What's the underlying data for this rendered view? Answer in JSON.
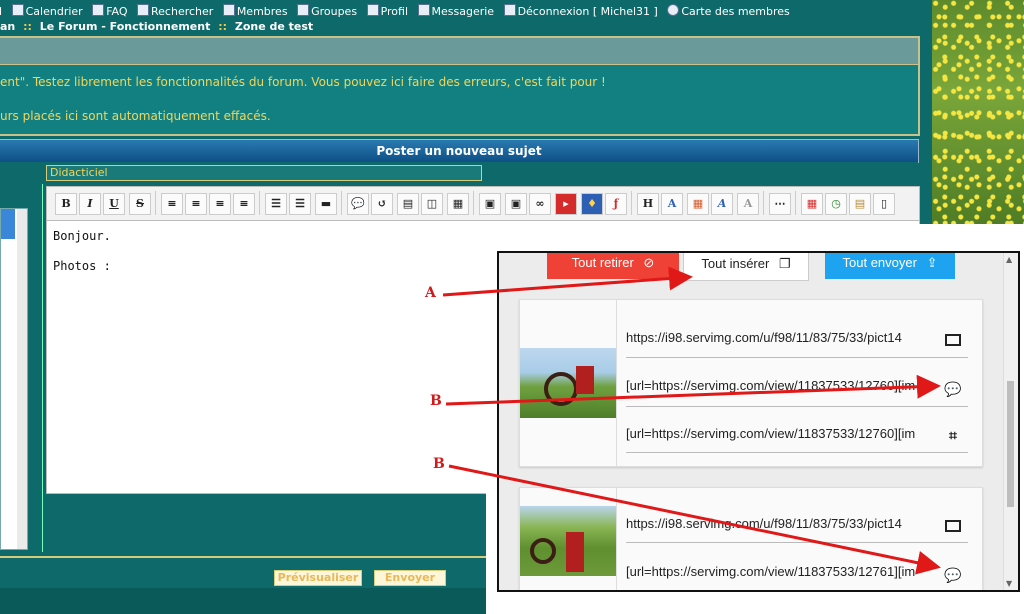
{
  "nav": {
    "items": [
      {
        "label": "il",
        "icon": "calendar-icon"
      },
      {
        "label": "Calendrier",
        "icon": "calendar-icon"
      },
      {
        "label": "FAQ",
        "icon": "help-icon"
      },
      {
        "label": "Rechercher",
        "icon": "search-icon"
      },
      {
        "label": "Membres",
        "icon": "members-icon"
      },
      {
        "label": "Groupes",
        "icon": "groups-icon"
      },
      {
        "label": "Profil",
        "icon": "profile-icon"
      },
      {
        "label": "Messagerie",
        "icon": "mail-icon"
      },
      {
        "label": "Déconnexion [ Michel31 ]",
        "icon": "logout-icon"
      },
      {
        "label": "Carte des membres",
        "icon": "globe-icon"
      }
    ],
    "breadcrumb": [
      "an",
      "Le Forum - Fonctionnement",
      "Zone de test"
    ],
    "breadcrumb_sep": "::"
  },
  "info": {
    "line1": "ent\". Testez librement les fonctionnalités du forum. Vous pouvez ici faire des erreurs, c'est fait pour !",
    "line2": "urs placés ici sont automatiquement effacés."
  },
  "form": {
    "header": "Poster un nouveau sujet",
    "title_value": "Didacticiel",
    "editor_lines": [
      "Bonjour.",
      "Photos :"
    ],
    "preview_label": "Prévisualiser",
    "send_label": "Envoyer"
  },
  "popup": {
    "remove_all": "Tout retirer",
    "insert_all": "Tout insérer",
    "send_all": "Tout envoyer",
    "cards": [
      {
        "rows": [
          {
            "text": "https://i98.servimg.com/u/f98/11/83/75/33/pict14",
            "icon": "image-icon"
          },
          {
            "text": "[url=https://servimg.com/view/11837533/12760][im",
            "icon": "chat-icon"
          },
          {
            "text": "[url=https://servimg.com/view/11837533/12760][im",
            "icon": "crop-icon"
          }
        ]
      },
      {
        "rows": [
          {
            "text": "https://i98.servimg.com/u/f98/11/83/75/33/pict14",
            "icon": "image-icon"
          },
          {
            "text": "[url=https://servimg.com/view/11837533/12761][im",
            "icon": "chat-icon"
          }
        ]
      }
    ]
  },
  "annotations": {
    "a": "A",
    "b1": "B",
    "b2": "B",
    "color": "#d31a1a"
  }
}
